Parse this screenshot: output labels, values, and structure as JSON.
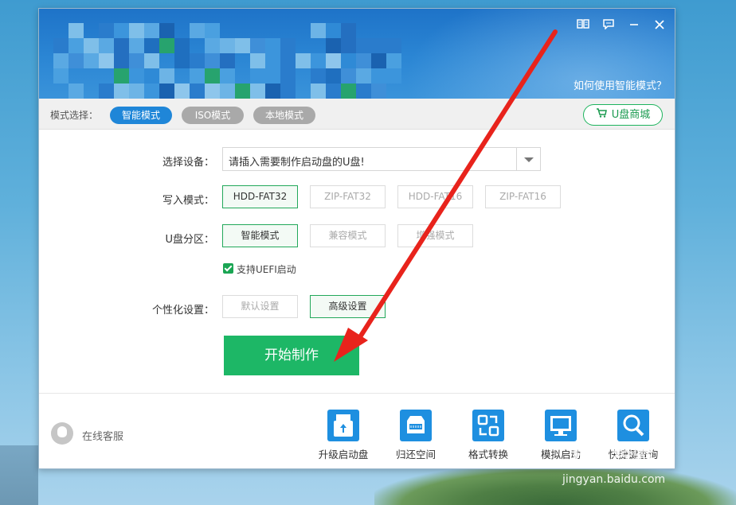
{
  "window": {
    "help_link": "如何使用智能模式？",
    "controls": [
      "book-icon",
      "message-icon",
      "minimize-icon",
      "close-icon"
    ]
  },
  "modebar": {
    "label": "模式选择：",
    "modes": [
      {
        "label": "智能模式",
        "active": true
      },
      {
        "label": "ISO模式",
        "active": false
      },
      {
        "label": "本地模式",
        "active": false
      }
    ],
    "shop_button": "U盘商城"
  },
  "form": {
    "device_label": "选择设备：",
    "device_placeholder": "请插入需要制作启动盘的U盘!",
    "write_mode_label": "写入模式：",
    "write_modes": [
      "HDD-FAT32",
      "ZIP-FAT32",
      "HDD-FAT16",
      "ZIP-FAT16"
    ],
    "write_mode_selected": "HDD-FAT32",
    "partition_label": "U盘分区：",
    "partitions": [
      "智能模式",
      "兼容模式",
      "增强模式"
    ],
    "partition_selected": "智能模式",
    "uefi_label": "支持UEFI启动",
    "uefi_checked": true,
    "personal_label": "个性化设置：",
    "personal_options": [
      "默认设置",
      "高级设置"
    ],
    "personal_selected": "高级设置",
    "start_button": "开始制作"
  },
  "footer": {
    "customer_service": "在线客服",
    "tools": [
      {
        "label": "升级启动盘",
        "icon": "upgrade-usb-icon"
      },
      {
        "label": "归还空间",
        "icon": "restore-space-icon"
      },
      {
        "label": "格式转换",
        "icon": "format-convert-icon"
      },
      {
        "label": "模拟启动",
        "icon": "simulate-boot-icon"
      },
      {
        "label": "快捷键查询",
        "icon": "hotkey-query-icon"
      }
    ]
  },
  "watermark": {
    "logo": "Bai 经验",
    "url": "jingyan.baidu.com"
  },
  "colors": {
    "header_blue": "#1e73c8",
    "accent_green": "#1db766",
    "annotation_red": "#e8231c"
  }
}
